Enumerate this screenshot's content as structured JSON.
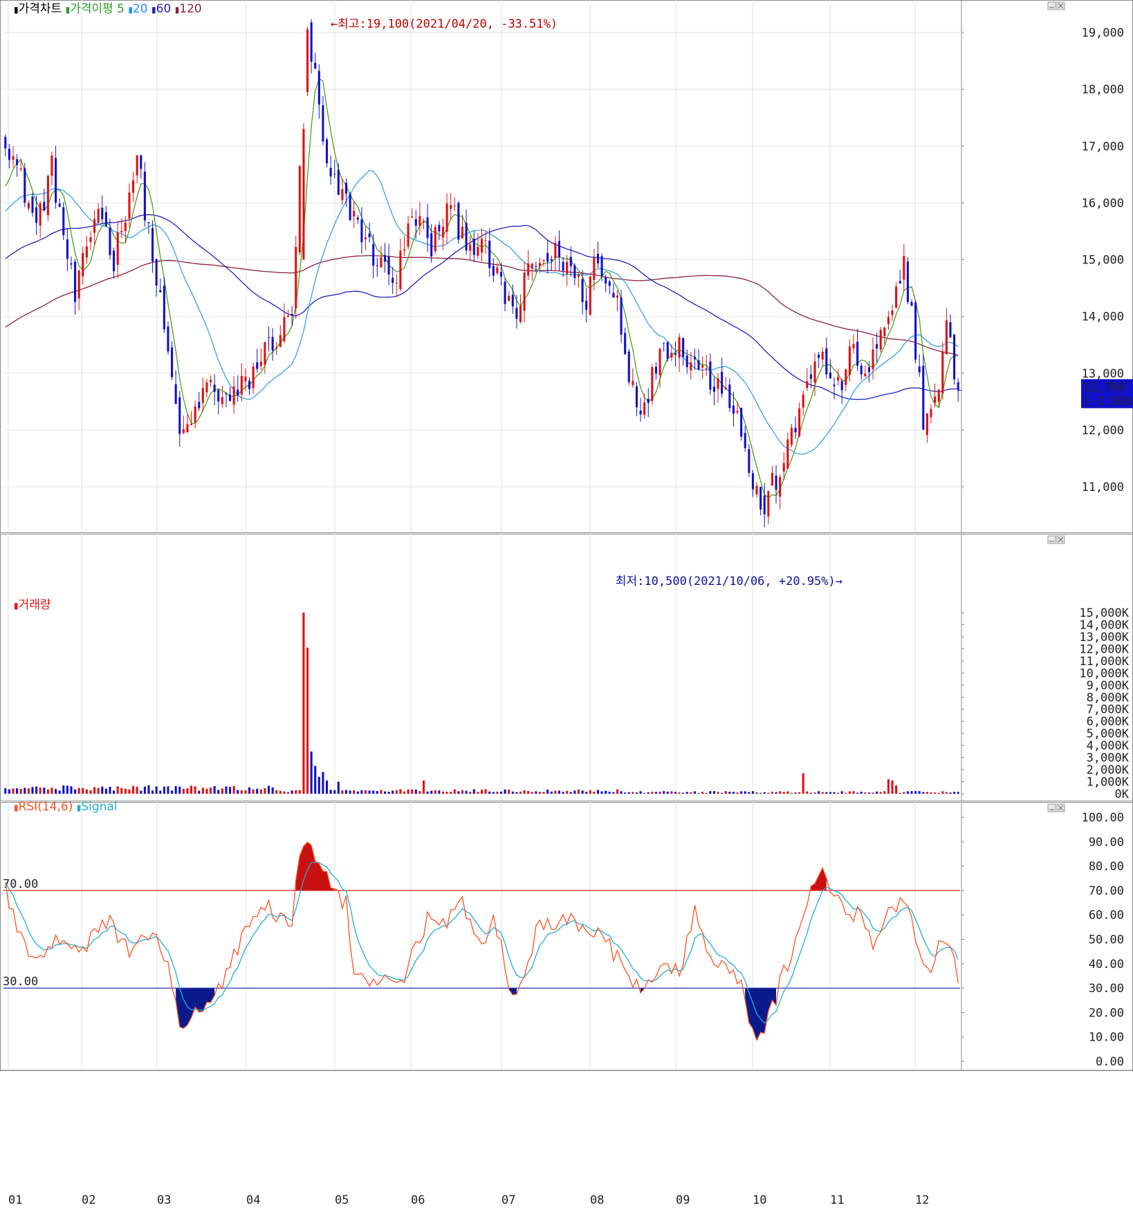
{
  "chart_data": [
    {
      "type": "candlestick",
      "legend": [
        {
          "label": "가격차트",
          "color": "#000000"
        },
        {
          "label": "가격이평",
          "color": "#2a9a2a"
        },
        {
          "label": "5",
          "color": "#2a9a2a"
        },
        {
          "label": "20",
          "color": "#1e90ff"
        },
        {
          "label": "60",
          "color": "#2020c0"
        },
        {
          "label": "120",
          "color": "#8b2040"
        }
      ],
      "y_ticks": [
        "19,000",
        "18,000",
        "17,000",
        "16,000",
        "15,000",
        "14,000",
        "13,000",
        "12,000",
        "11,000"
      ],
      "ylim": [
        10500,
        19300
      ],
      "current_price": "12,700",
      "current_change": "(-1.93%)",
      "high_annotation": "←최고:19,100(2021/04/20, -33.51%)",
      "low_annotation": "최저:10,500(2021/10/06, +20.95%)→",
      "months": [
        "01",
        "02",
        "03",
        "04",
        "05",
        "06",
        "07",
        "08",
        "09",
        "10",
        "11",
        "12"
      ],
      "monthly_close": [
        15000,
        15300,
        12600,
        13300,
        15800,
        15000,
        14400,
        15100,
        13300,
        11300,
        13200,
        12700
      ],
      "ma5_close": 12900,
      "ma20_close": 13300,
      "ma60_close": 12700,
      "ma120_close": 13600
    },
    {
      "type": "bar",
      "title": "거래량",
      "y_ticks": [
        "15,000K",
        "14,000K",
        "13,000K",
        "12,000K",
        "11,000K",
        "10,000K",
        "9,000K",
        "8,000K",
        "7,000K",
        "6,000K",
        "5,000K",
        "4,000K",
        "3,000K",
        "2,000K",
        "1,000K",
        "0K"
      ],
      "ylim": [
        0,
        15000
      ],
      "unit": "K",
      "peaks": [
        {
          "month": "04",
          "value": 15000
        },
        {
          "month": "04",
          "value": 12100
        },
        {
          "month": "05",
          "value": 3500
        },
        {
          "month": "10",
          "value": 1700
        }
      ]
    },
    {
      "type": "line",
      "legend": [
        {
          "label": "RSI(14,6)",
          "color": "#ff5020"
        },
        {
          "label": "Signal",
          "color": "#20b0d0"
        }
      ],
      "y_ticks": [
        "100.00",
        "90.00",
        "80.00",
        "70.00",
        "60.00",
        "50.00",
        "40.00",
        "30.00",
        "20.00",
        "10.00",
        "0.00"
      ],
      "ylim": [
        0,
        100
      ],
      "upper_line": {
        "label": "70.00",
        "value": 70
      },
      "lower_line": {
        "label": "30.00",
        "value": 30
      },
      "rsi_monthly": [
        66,
        44,
        12,
        55,
        70,
        48,
        22,
        52,
        44,
        14,
        70,
        32
      ],
      "x_labels": [
        "01",
        "02",
        "03",
        "04",
        "05",
        "06",
        "07",
        "08",
        "09",
        "10",
        "11",
        "12"
      ]
    }
  ]
}
